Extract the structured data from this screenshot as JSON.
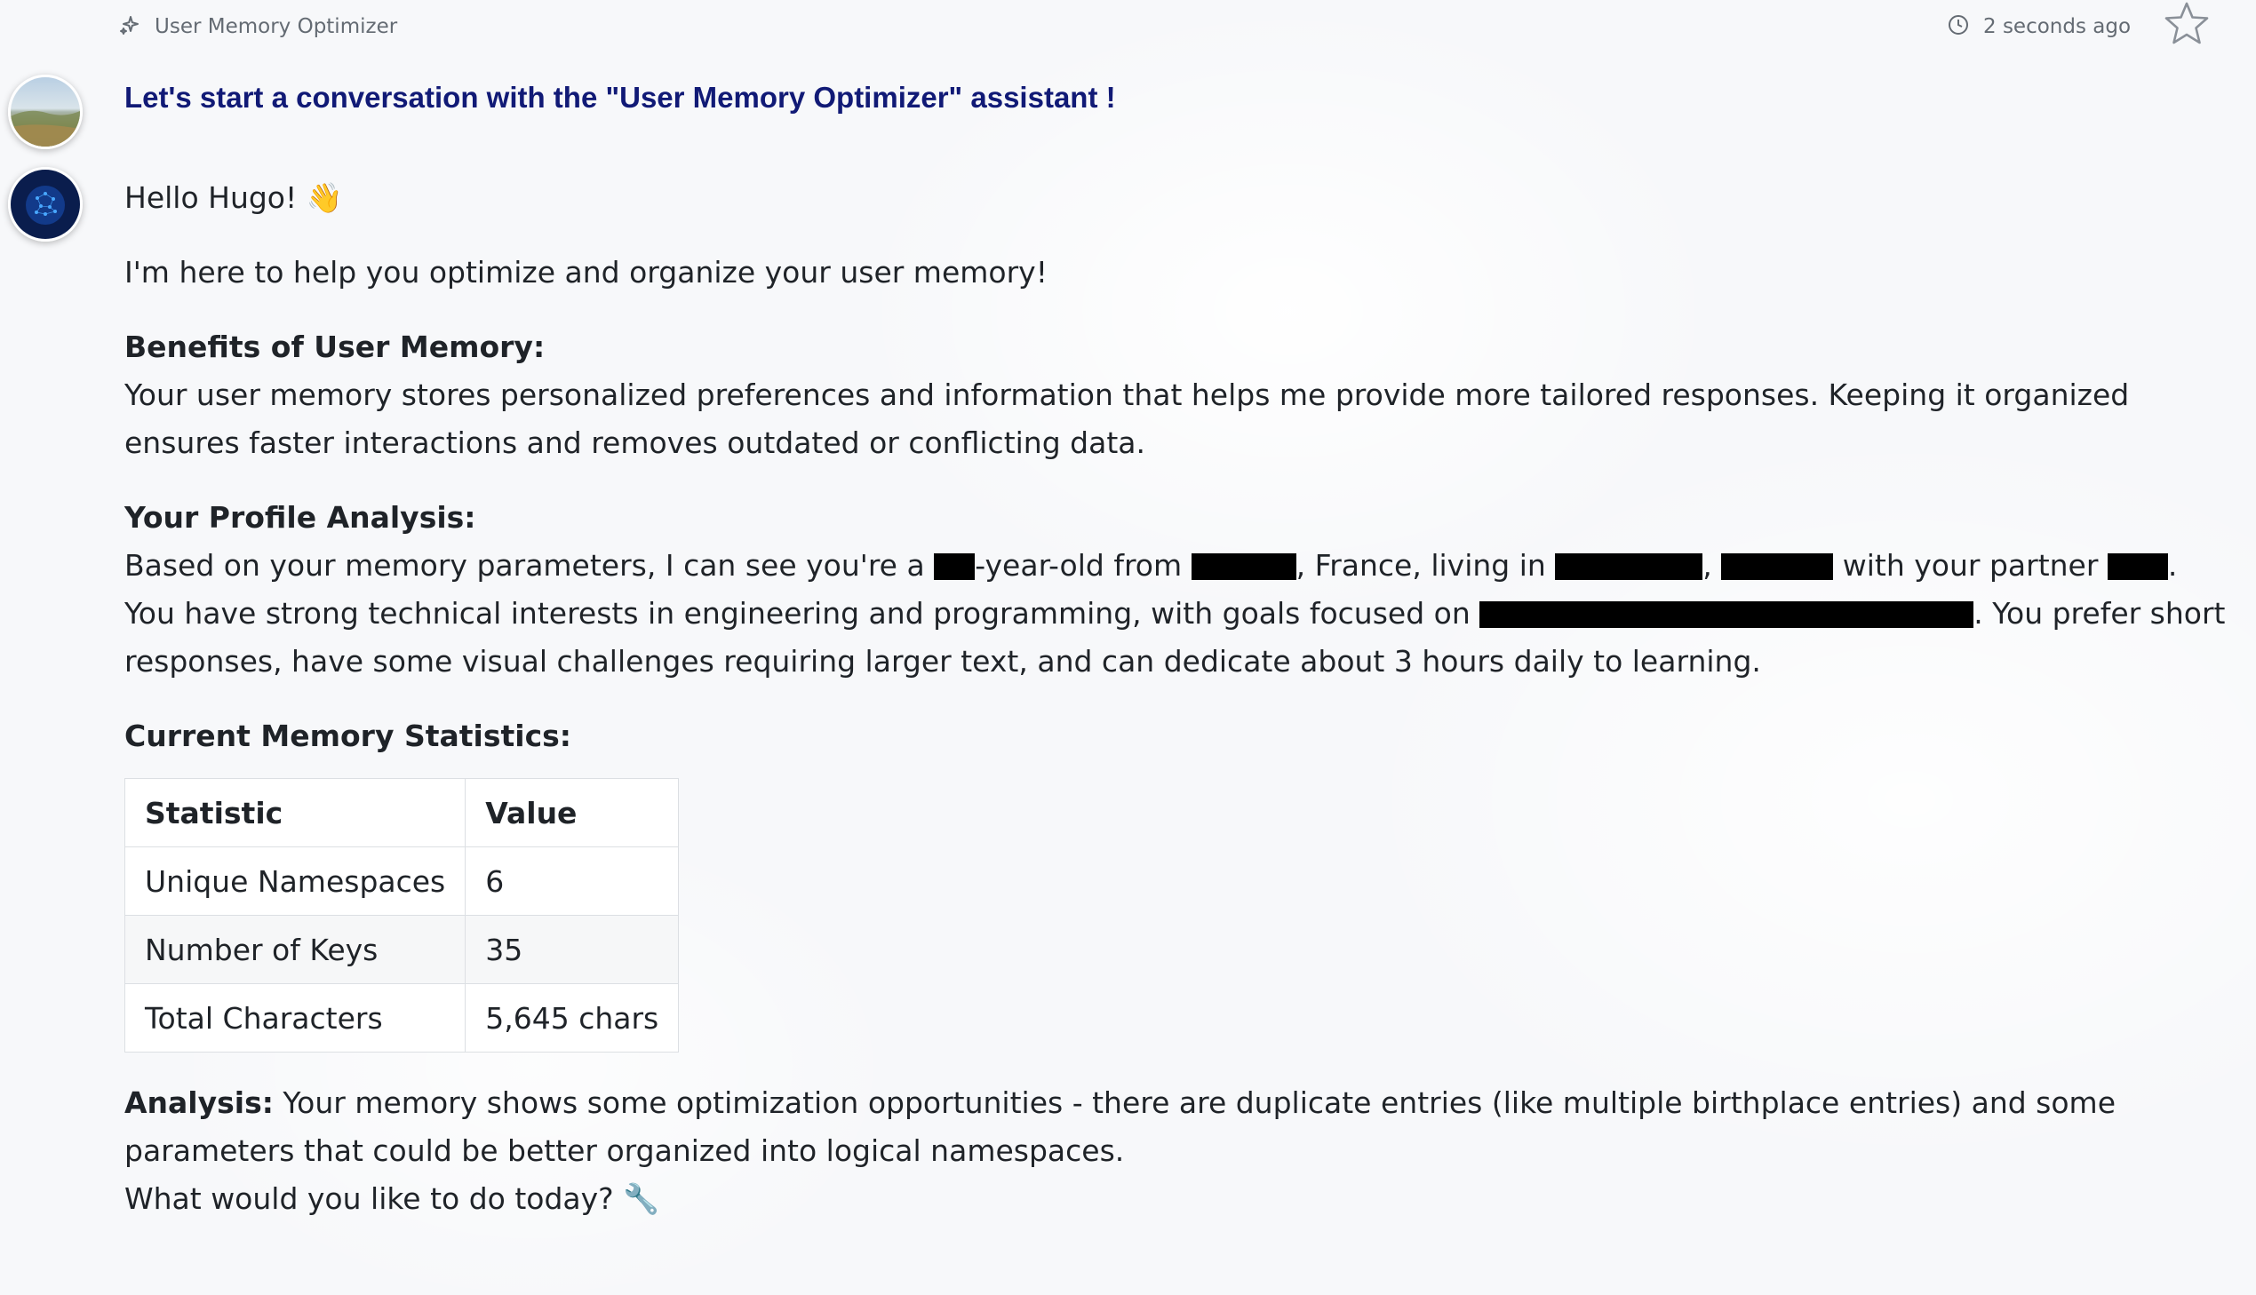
{
  "header": {
    "assistant_name": "User Memory Optimizer",
    "timestamp": "2 seconds ago",
    "icons": {
      "assistant": "sparkle-icon",
      "time": "clock-icon",
      "favorite": "star-icon"
    }
  },
  "conversation": {
    "intro": "Let's start a conversation with the \"User Memory Optimizer\" assistant !",
    "greeting": "Hello Hugo! 👋",
    "help_line": "I'm here to help you optimize and organize your user memory!",
    "benefits": {
      "heading": "Benefits of User Memory:",
      "text": "Your user memory stores personalized preferences and information that helps me provide more tailored responses. Keeping it organized ensures faster interactions and removes outdated or conflicting data."
    },
    "profile": {
      "heading": "Your Profile Analysis:",
      "t1": "Based on your memory parameters, I can see you're a ",
      "t2": "-year-old from ",
      "t3": ", France, living in ",
      "t4": ", ",
      "t5": " with your partner ",
      "t6": ". You have strong technical interests in engineering and programming, with goals focused on ",
      "t7": ". You prefer short responses, have some visual challenges requiring larger text, and can dedicate about 3 hours daily to learning."
    },
    "stats": {
      "heading": "Current Memory Statistics:",
      "columns": [
        "Statistic",
        "Value"
      ],
      "rows": [
        [
          "Unique Namespaces",
          "6"
        ],
        [
          "Number of Keys",
          "35"
        ],
        [
          "Total Characters",
          "5,645 chars"
        ]
      ]
    },
    "analysis": {
      "label": "Analysis:",
      "text": " Your memory shows some optimization opportunities - there are duplicate entries (like multiple birthplace entries) and some parameters that could be better organized into logical namespaces."
    },
    "closing": "What would you like to do today? 🔧"
  },
  "colors": {
    "intro_text": "#111a76",
    "body_text": "#1f2328",
    "muted_text": "#646b73",
    "background": "#f7f8fa",
    "redaction": "#000000"
  }
}
